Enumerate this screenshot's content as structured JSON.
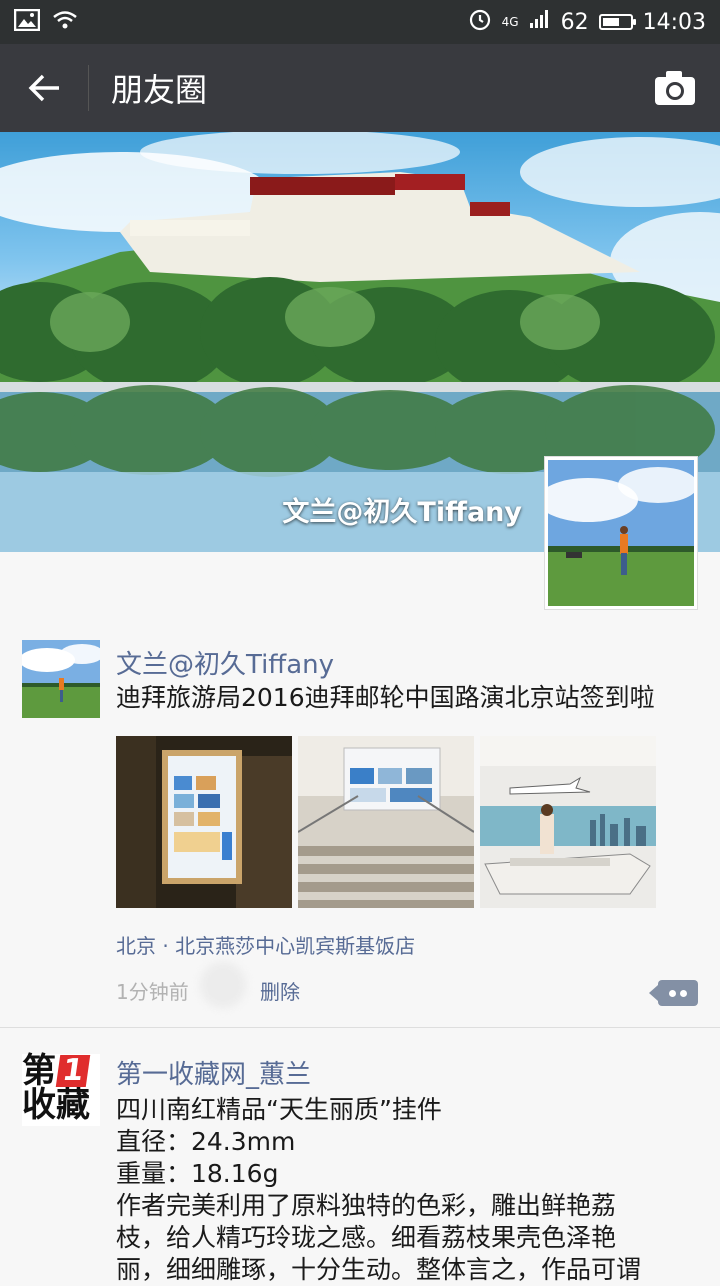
{
  "status_bar": {
    "network": "4G",
    "battery": "62",
    "battery_level": 0.62,
    "time": "14:03"
  },
  "nav": {
    "title": "朋友圈"
  },
  "cover": {
    "user_name": "文兰@初久Tiffany"
  },
  "posts": [
    {
      "user": "文兰@初久Tiffany",
      "text": "迪拜旅游局2016迪拜邮轮中国路演北京站签到啦",
      "location": "北京 · 北京燕莎中心凯宾斯基饭店",
      "time": "1分钟前",
      "delete_label": "删除",
      "photos": [
        "photo-1",
        "photo-2",
        "photo-3"
      ]
    },
    {
      "user": "第一收藏网_蕙兰",
      "logo_line1": "第",
      "logo_one": "1",
      "logo_line2": "收藏",
      "lines": [
        "四川南红精品“天生丽质”挂件",
        "直径：24.3mm",
        "重量：18.16g",
        "作者完美利用了原料独特的色彩，雕出鲜艳荔",
        "枝，给人精巧玲珑之感。细看荔枝果壳色泽艳",
        "丽，细细雕琢，十分生动。整体言之，作品可谓"
      ]
    }
  ],
  "colors": {
    "status_bar": "#2e3132",
    "nav_bar": "#393a3f",
    "link": "#576b95",
    "background": "#f7f7f7"
  }
}
